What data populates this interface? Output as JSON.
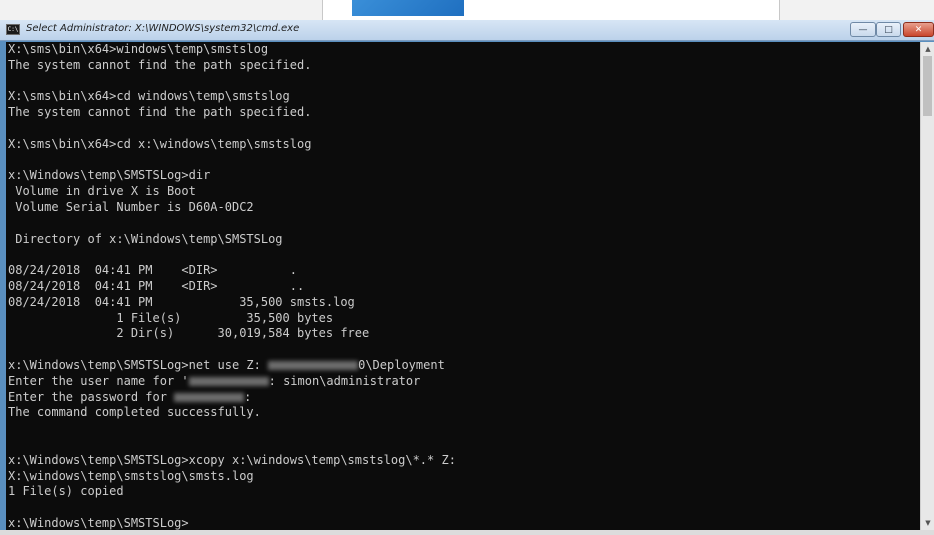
{
  "window": {
    "title": "Select Administrator: X:\\WINDOWS\\system32\\cmd.exe",
    "icon": "cmd-icon",
    "controls": {
      "minimize": "minimize-icon",
      "maximize": "maximize-icon",
      "close": "close-icon"
    }
  },
  "console": {
    "line1": "X:\\sms\\bin\\x64>windows\\temp\\smstslog",
    "line2": "The system cannot find the path specified.",
    "line3": "",
    "line4": "X:\\sms\\bin\\x64>cd windows\\temp\\smstslog",
    "line5": "The system cannot find the path specified.",
    "line6": "",
    "line7": "X:\\sms\\bin\\x64>cd x:\\windows\\temp\\smstslog",
    "line8": "",
    "line9": "x:\\Windows\\temp\\SMSTSLog>dir",
    "line10": " Volume in drive X is Boot",
    "line11": " Volume Serial Number is D60A-0DC2",
    "line12": "",
    "line13": " Directory of x:\\Windows\\temp\\SMSTSLog",
    "line14": "",
    "line15": "08/24/2018  04:41 PM    <DIR>          .",
    "line16": "08/24/2018  04:41 PM    <DIR>          ..",
    "line17": "08/24/2018  04:41 PM            35,500 smsts.log",
    "line18": "               1 File(s)         35,500 bytes",
    "line19": "               2 Dir(s)      30,019,584 bytes free",
    "line20": "",
    "line21a": "x:\\Windows\\temp\\SMSTSLog>net use Z: ",
    "line21b": "0\\Deployment",
    "line22a": "Enter the user name for '",
    "line22b": ": simon\\administrator",
    "line23a": "Enter the password for ",
    "line23b": ":",
    "line24": "The command completed successfully.",
    "line25": "",
    "line26": "",
    "line27": "x:\\Windows\\temp\\SMSTSLog>xcopy x:\\windows\\temp\\smstslog\\*.* Z:",
    "line28": "X:\\windows\\temp\\smstslog\\smsts.log",
    "line29": "1 File(s) copied",
    "line30": "",
    "line31": "x:\\Windows\\temp\\SMSTSLog>"
  },
  "colors": {
    "console_bg": "#0c0c0c",
    "console_text": "#cccccc",
    "titlebar": "#c8dcf0",
    "close_button": "#c9452c"
  }
}
